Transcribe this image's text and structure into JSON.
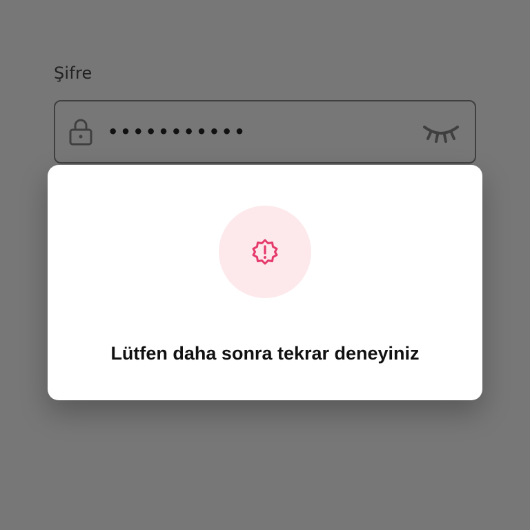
{
  "form": {
    "password_label": "Şifre",
    "password_masked": "•••••••••••",
    "icons": {
      "leading": "lock-icon",
      "trailing": "eye-closed-icon"
    }
  },
  "modal": {
    "icon": "alert-badge-icon",
    "message": "Lütfen daha sonra tekrar deneyiniz",
    "colors": {
      "accent": "#e5396a",
      "icon_background": "#fde9ec"
    }
  }
}
